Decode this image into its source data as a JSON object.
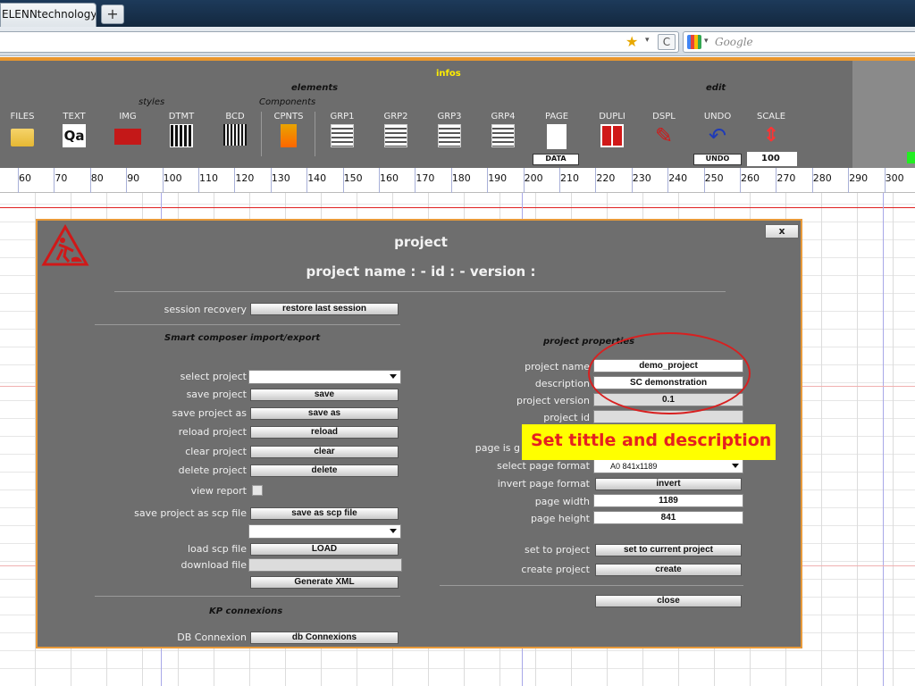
{
  "browser": {
    "tab_title": "ELENNtechnology",
    "new_tab": "+",
    "search_placeholder": "Google",
    "reload_glyph": "C",
    "bookmark_icon": "star-icon"
  },
  "toolbar": {
    "infos": "infos",
    "styles": "styles",
    "elements": "elements",
    "components": "Components",
    "edit": "edit",
    "tools": [
      {
        "label": "FILES",
        "icon": "folder-icon"
      },
      {
        "label": "TEXT",
        "icon": "text-icon",
        "glyph": "Qa"
      },
      {
        "label": "IMG",
        "icon": "image-icon"
      },
      {
        "label": "DTMT",
        "icon": "datamatrix-icon"
      },
      {
        "label": "BCD",
        "icon": "barcode-icon"
      },
      {
        "label": "CPNTS",
        "icon": "components-icon"
      },
      {
        "label": "GRP1",
        "icon": "group-icon"
      },
      {
        "label": "GRP2",
        "icon": "group-icon"
      },
      {
        "label": "GRP3",
        "icon": "group-icon"
      },
      {
        "label": "GRP4",
        "icon": "group-icon"
      },
      {
        "label": "PAGE",
        "icon": "page-icon"
      },
      {
        "label": "DUPLI",
        "icon": "duplicate-icon"
      },
      {
        "label": "DSPL",
        "icon": "wrench-icon"
      },
      {
        "label": "UNDO",
        "icon": "undo-icon"
      },
      {
        "label": "SCALE",
        "icon": "scale-icon"
      }
    ],
    "data_btn": "DATA",
    "undo_btn": "UNDO",
    "scale_value": "100"
  },
  "ruler": [
    "60",
    "70",
    "80",
    "90",
    "100",
    "110",
    "120",
    "130",
    "140",
    "150",
    "160",
    "170",
    "180",
    "190",
    "200",
    "210",
    "220",
    "230",
    "240",
    "250",
    "260",
    "270",
    "280",
    "290",
    "300"
  ],
  "dialog": {
    "close_label": "x",
    "title": "project",
    "subtitle": "project name : - id : - version :",
    "left": {
      "session_recovery_label": "session recovery",
      "restore_btn": "restore last session",
      "smart_composer_section": "Smart composer import/export",
      "select_project_label": "select project",
      "select_project_value": "",
      "save_project_label": "save project",
      "save_btn": "save",
      "save_as_label": "save project as",
      "save_as_btn": "save as",
      "reload_label": "reload project",
      "reload_btn": "reload",
      "clear_label": "clear project",
      "clear_btn": "clear",
      "delete_label": "delete project",
      "delete_btn": "delete",
      "view_report_label": "view report",
      "save_scp_label": "save project as scp file",
      "save_scp_btn": "save as scp file",
      "scp_select_value": "",
      "load_scp_label": "load scp file",
      "load_btn": "LOAD",
      "download_label": "download file",
      "download_value": "",
      "generate_btn": "Generate XML",
      "kp_section": "KP connexions",
      "db_label": "DB Connexion",
      "db_btn": "db Connexions"
    },
    "right": {
      "section": "project properties",
      "name_label": "project name",
      "name_value": "demo_project",
      "desc_label": "description",
      "desc_value": "SC demonstration",
      "version_label": "project version",
      "version_value": "0.1",
      "id_label": "project id",
      "id_value": "",
      "page_is_label": "page is g",
      "page_format_label": "select page format",
      "page_format_value": "A0 841x1189",
      "invert_label": "invert page format",
      "invert_btn": "invert",
      "width_label": "page width",
      "width_value": "1189",
      "height_label": "page height",
      "height_value": "841",
      "set_label": "set to project",
      "set_btn": "set to current project",
      "create_label": "create project",
      "create_btn": "create",
      "close_btn": "close"
    }
  },
  "annotation": {
    "callout_text": "Set tittle and description",
    "ellipse_color": "#d82020",
    "callout_bg": "#ffff00"
  }
}
